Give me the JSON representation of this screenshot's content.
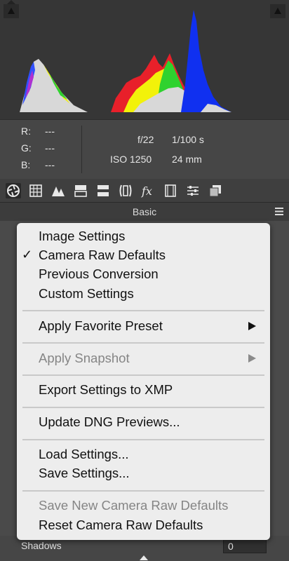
{
  "readout": {
    "r_label": "R:",
    "r_value": "---",
    "g_label": "G:",
    "g_value": "---",
    "b_label": "B:",
    "b_value": "---",
    "aperture": "f/22",
    "shutter": "1/100 s",
    "iso": "ISO 1250",
    "focal_length": "24 mm"
  },
  "toolbar": {
    "icons": [
      "basic-icon",
      "tone-curve-icon",
      "detail-icon",
      "hsl-icon",
      "split-toning-icon",
      "lens-corrections-icon",
      "effects-icon",
      "camera-calibration-icon",
      "presets-icon",
      "snapshots-icon"
    ],
    "active_index": 0
  },
  "panel": {
    "title": "Basic"
  },
  "menu": {
    "items": [
      {
        "label": "Image Settings",
        "enabled": true,
        "checked": false
      },
      {
        "label": "Camera Raw Defaults",
        "enabled": true,
        "checked": true
      },
      {
        "label": "Previous Conversion",
        "enabled": true,
        "checked": false
      },
      {
        "label": "Custom Settings",
        "enabled": true,
        "checked": false
      },
      {
        "label": "Apply Favorite Preset",
        "enabled": true,
        "submenu": true
      },
      {
        "label": "Apply Snapshot",
        "enabled": false,
        "submenu": true
      },
      {
        "label": "Export Settings to XMP",
        "enabled": true
      },
      {
        "label": "Update DNG Previews...",
        "enabled": true
      },
      {
        "label": "Load Settings...",
        "enabled": true
      },
      {
        "label": "Save Settings...",
        "enabled": true
      },
      {
        "label": "Save New Camera Raw Defaults",
        "enabled": false
      },
      {
        "label": "Reset Camera Raw Defaults",
        "enabled": true
      }
    ],
    "check_mark": "✓"
  },
  "shadows": {
    "label": "Shadows",
    "value": "0"
  },
  "colors": {
    "accent_red": "#e8202a",
    "accent_green": "#2fd22f",
    "accent_blue": "#1030f0",
    "accent_yellow": "#f2f20a"
  }
}
